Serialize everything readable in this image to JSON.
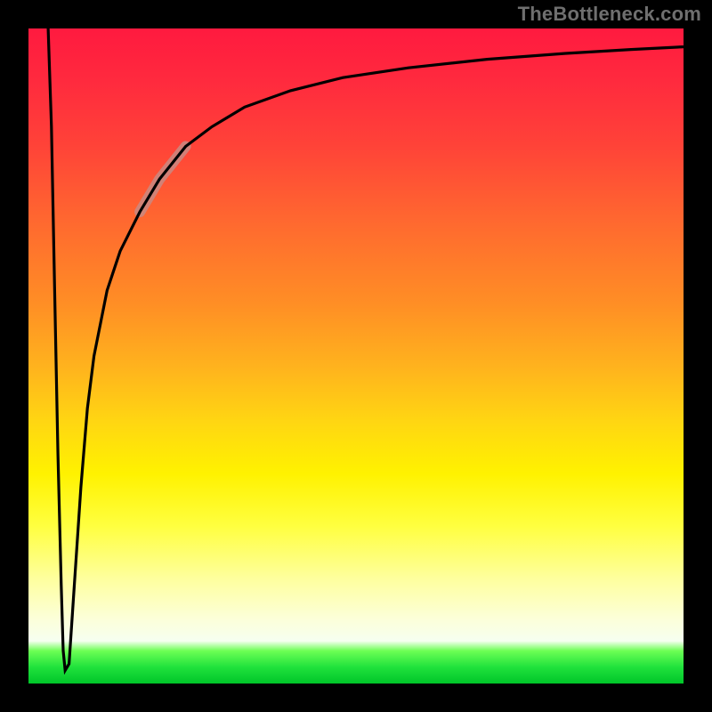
{
  "watermark": "TheBottleneck.com",
  "colors": {
    "frame": "#000000",
    "watermark": "#6f6f6f",
    "curve": "#000000",
    "highlight": "#c98a83",
    "gradient_stops": [
      "#ff1a3f",
      "#ff2a3e",
      "#ff4338",
      "#ff6a2f",
      "#ff8e25",
      "#ffb41d",
      "#ffd612",
      "#fff200",
      "#ffff40",
      "#feff9e",
      "#fcffd8",
      "#f6fff0",
      "#6dff55",
      "#20e23c",
      "#00c529"
    ]
  },
  "chart_data": {
    "type": "line",
    "title": "",
    "xlabel": "",
    "ylabel": "",
    "xlim": [
      0,
      100
    ],
    "ylim": [
      0,
      100
    ],
    "grid": false,
    "legend": false,
    "note": "Axes are unitless (no ticks shown). y=100 is top of plot; y=0 is bottom. x runs left→right.",
    "series": [
      {
        "name": "spike-down",
        "x": [
          3.0,
          3.5,
          4.0,
          4.5,
          5.0,
          5.3,
          5.6,
          6.2
        ],
        "y": [
          100,
          85,
          60,
          35,
          15,
          5,
          2,
          3
        ]
      },
      {
        "name": "recovery-curve",
        "x": [
          6.2,
          7.0,
          8.0,
          9.0,
          10,
          12,
          14,
          17,
          20,
          24,
          28,
          33,
          40,
          48,
          58,
          70,
          82,
          92,
          100
        ],
        "y": [
          3,
          15,
          30,
          42,
          50,
          60,
          66,
          72,
          77,
          82,
          85,
          88,
          90.5,
          92.5,
          94,
          95.3,
          96.2,
          96.8,
          97.2
        ]
      }
    ],
    "highlight_segment": {
      "series": "recovery-curve",
      "x_range": [
        17,
        26
      ],
      "approx_y_range": [
        72,
        84
      ]
    }
  }
}
